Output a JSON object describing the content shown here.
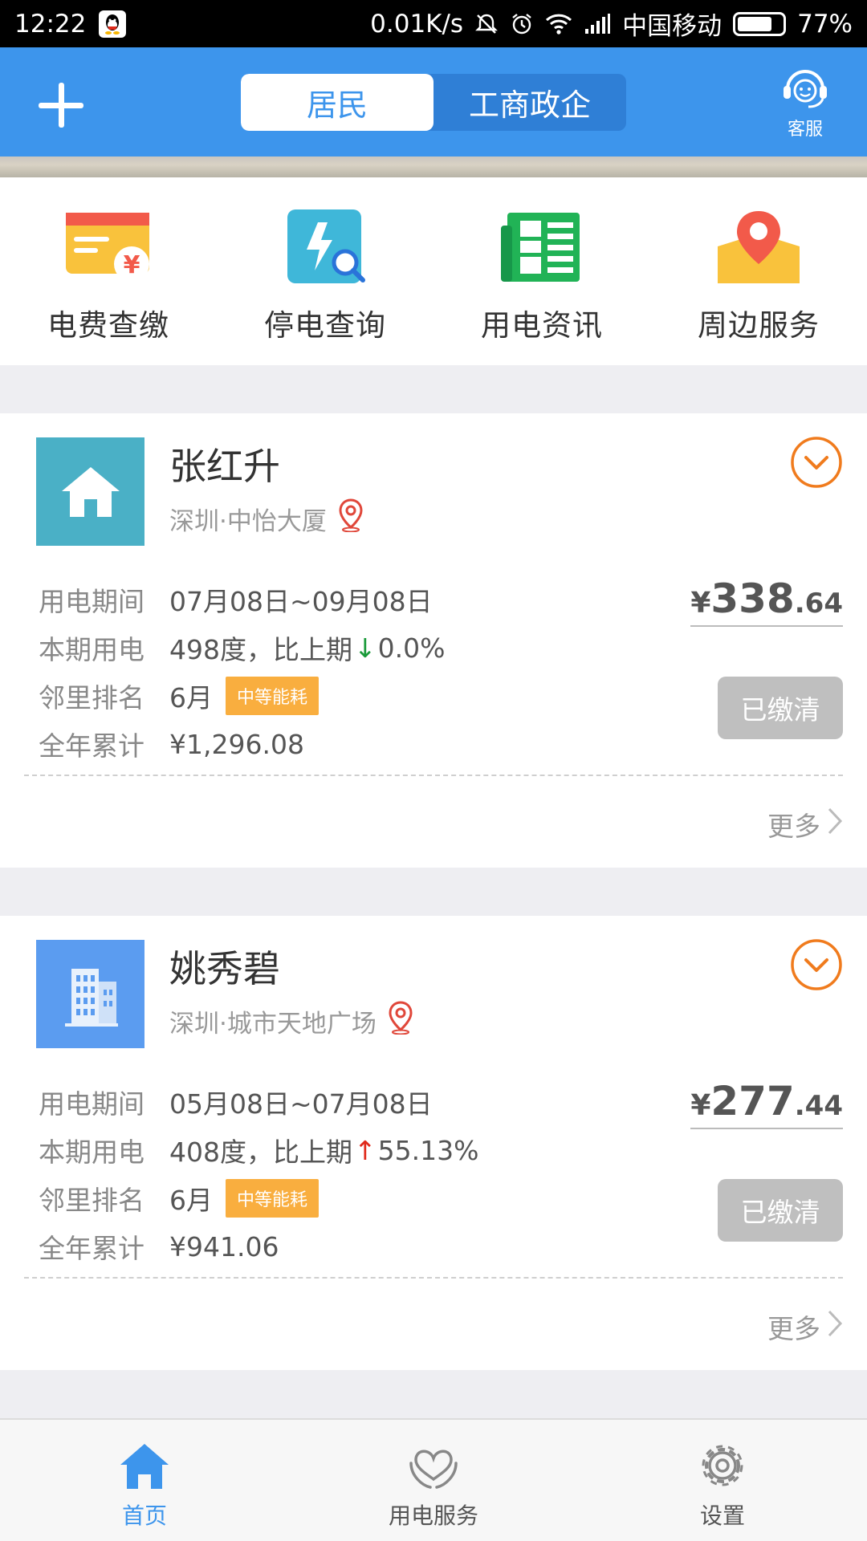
{
  "status_bar": {
    "time": "12:22",
    "net_speed": "0.01K/s",
    "carrier": "中国移动",
    "battery": "77%",
    "battery_level": 0.77
  },
  "header": {
    "tabs": [
      {
        "label": "居民",
        "active": true
      },
      {
        "label": "工商政企",
        "active": false
      }
    ],
    "service_label": "客服"
  },
  "quick_nav": [
    {
      "label": "电费查缴",
      "icon": "bill-icon"
    },
    {
      "label": "停电查询",
      "icon": "outage-search-icon"
    },
    {
      "label": "用电资讯",
      "icon": "news-icon"
    },
    {
      "label": "周边服务",
      "icon": "nearby-map-icon"
    }
  ],
  "labels": {
    "period": "用电期间",
    "usage": "本期用电",
    "ranking": "邻里排名",
    "annual": "全年累计",
    "more": "更多"
  },
  "accounts": [
    {
      "name": "张红升",
      "location": "深圳·中怡大厦",
      "type_icon": "house-icon",
      "period": "07月08日~09月08日",
      "usage_text": "498度，比上期",
      "trend": "↓",
      "trend_value": "0.0%",
      "ranking_month": "6月",
      "ranking_tag": "中等能耗",
      "annual_total": "¥1,296.08",
      "amount_currency": "¥",
      "amount_int": "338",
      "amount_dec": ".64",
      "status": "已缴清",
      "avatar_color": "#4ab0c6"
    },
    {
      "name": "姚秀碧",
      "location": "深圳·城市天地广场",
      "type_icon": "building-icon",
      "period": "05月08日~07月08日",
      "usage_text": "408度，比上期",
      "trend": "↑",
      "trend_value": "55.13%",
      "ranking_month": "6月",
      "ranking_tag": "中等能耗",
      "annual_total": "¥941.06",
      "amount_currency": "¥",
      "amount_int": "277",
      "amount_dec": ".44",
      "status": "已缴清",
      "avatar_color": "#5b9cf0"
    }
  ],
  "tabbar": [
    {
      "label": "首页",
      "icon": "home-icon",
      "active": true
    },
    {
      "label": "用电服务",
      "icon": "heart-hands-icon",
      "active": false
    },
    {
      "label": "设置",
      "icon": "gear-icon",
      "active": false
    }
  ],
  "colors": {
    "primary": "#3d95ec",
    "accent_orange": "#f07b1d",
    "tag": "#f9ae3f",
    "paid_button": "#bfbfbf"
  }
}
